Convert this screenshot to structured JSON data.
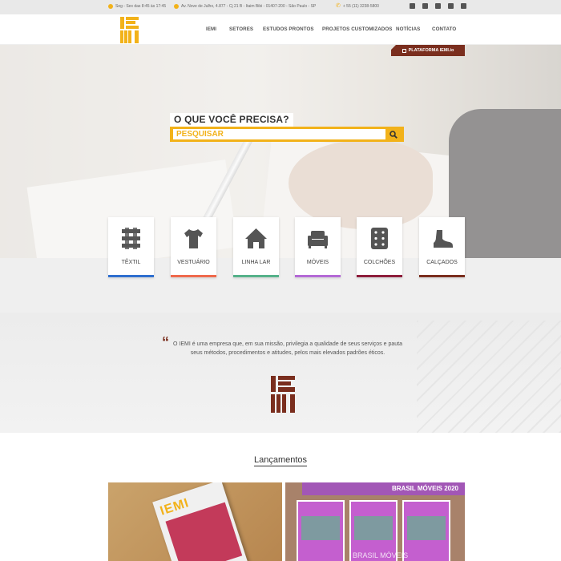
{
  "topbar": {
    "hours": "Seg - Sex das 8:45 às 17:45",
    "address": "Av. Nove de Julho, 4.877 - Cj 21 B - Itaim Bibi - 01407-200 - São Paulo - SP",
    "phone": "+ 55 (11) 3238-5800",
    "social": [
      "facebook-icon",
      "linkedin-icon",
      "instagram-icon",
      "twitter-icon",
      "youtube-icon"
    ]
  },
  "header": {
    "logo": "IEMI",
    "nav": [
      "IEMI",
      "SETORES",
      "ESTUDOS PRONTOS",
      "PROJETOS CUSTOMIZADOS",
      "NOTÍCIAS",
      "CONTATO"
    ]
  },
  "hero": {
    "platform_label": "PLATAFORMA IEMI.io",
    "search_title": "O QUE VOCÊ PRECISA?",
    "search_placeholder": "PESQUISAR"
  },
  "categories": [
    {
      "label": "TÊXTIL",
      "icon": "textile-icon",
      "color": "#2f6fcf"
    },
    {
      "label": "VESTUÁRIO",
      "icon": "shirt-icon",
      "color": "#ef6a4d"
    },
    {
      "label": "LINHA LAR",
      "icon": "house-icon",
      "color": "#56b28a"
    },
    {
      "label": "MÓVEIS",
      "icon": "sofa-icon",
      "color": "#b46ad6"
    },
    {
      "label": "COLCHÕES",
      "icon": "mattress-icon",
      "color": "#8e1e3c"
    },
    {
      "label": "CALÇADOS",
      "icon": "boot-icon",
      "color": "#7a2e1e"
    }
  ],
  "about": {
    "quote": "O IEMI é uma empresa que, em sua missão, privilegia a qualidade de seus serviços e pauta seus métodos, procedimentos e atitudes, pelos mais elevados padrões éticos."
  },
  "launches": {
    "title": "Lançamentos",
    "card2_header": "BRASIL MÓVEIS 2020",
    "card2_caption": "BRASIL MÓVEIS"
  },
  "colors": {
    "accent": "#f2b21a",
    "brand_dark": "#7a2e1e"
  }
}
